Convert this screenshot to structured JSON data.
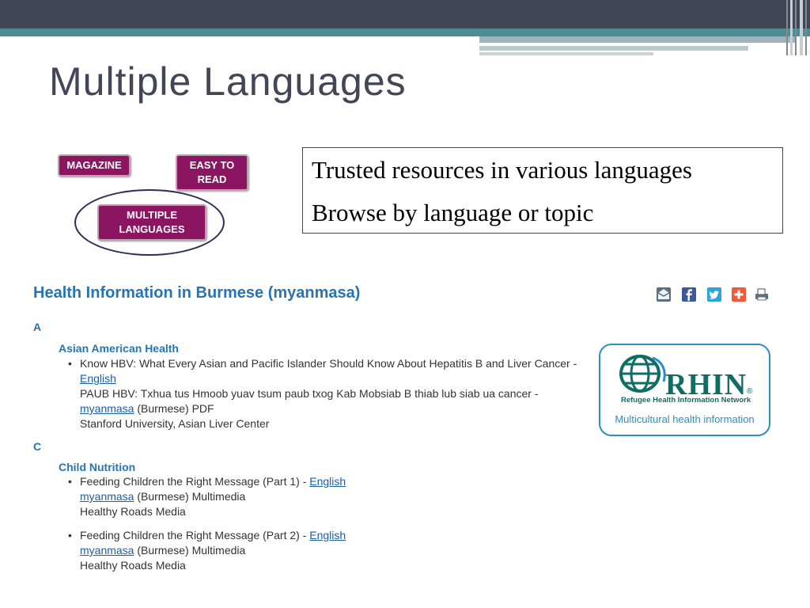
{
  "slide": {
    "title": "Multiple Languages"
  },
  "buttons": {
    "magazine": "MAGAZINE",
    "easy_line1": "EASY TO",
    "easy_line2": "READ",
    "multi_line1": "MULTIPLE",
    "multi_line2": "LANGUAGES"
  },
  "callout": {
    "line1": "Trusted resources in various languages",
    "line2": "Browse by language or topic"
  },
  "page": {
    "heading": "Health Information in Burmese (myanmasa)",
    "social_icons": [
      "email-icon",
      "facebook-icon",
      "twitter-icon",
      "addthis-icon",
      "print-icon"
    ],
    "sections": [
      {
        "letter": "A",
        "topic": "Asian American Health",
        "items": [
          {
            "title": "Know HBV: What Every Asian and Pacific Islander Should Know About Hepatitis B and Liver Cancer -",
            "link": "English",
            "title2": "PAUB HBV: Txhua tus Hmoob yuav tsum paub txog Kab Mobsiab B thiab lub siab ua cancer -",
            "lang_link": "myanmasa",
            "lang_suffix": "(Burmese)  PDF",
            "source": "Stanford University, Asian Liver Center"
          }
        ]
      },
      {
        "letter": "C",
        "topic": "Child Nutrition",
        "items": [
          {
            "title": "Feeding Children the Right Message (Part 1) -",
            "link": "English",
            "lang_link": "myanmasa",
            "lang_suffix": "(Burmese)  Multimedia",
            "source": "Healthy Roads Media"
          },
          {
            "title": "Feeding Children the Right Message (Part 2) -",
            "link": "English",
            "lang_link": "myanmasa",
            "lang_suffix": "(Burmese)  Multimedia",
            "source": "Healthy Roads Media"
          }
        ]
      }
    ]
  },
  "rhin": {
    "logo_text": "RHIN",
    "registered": "®",
    "network": "Refugee Health Information Network",
    "tagline": "Multicultural health information"
  },
  "colors": {
    "topbar": "#434656",
    "teal": "#4d8c93",
    "button": "#8b1560",
    "heading_blue": "#2675b2",
    "rhin_blue": "#2b8fc1",
    "rhin_green": "#0f6d64"
  }
}
